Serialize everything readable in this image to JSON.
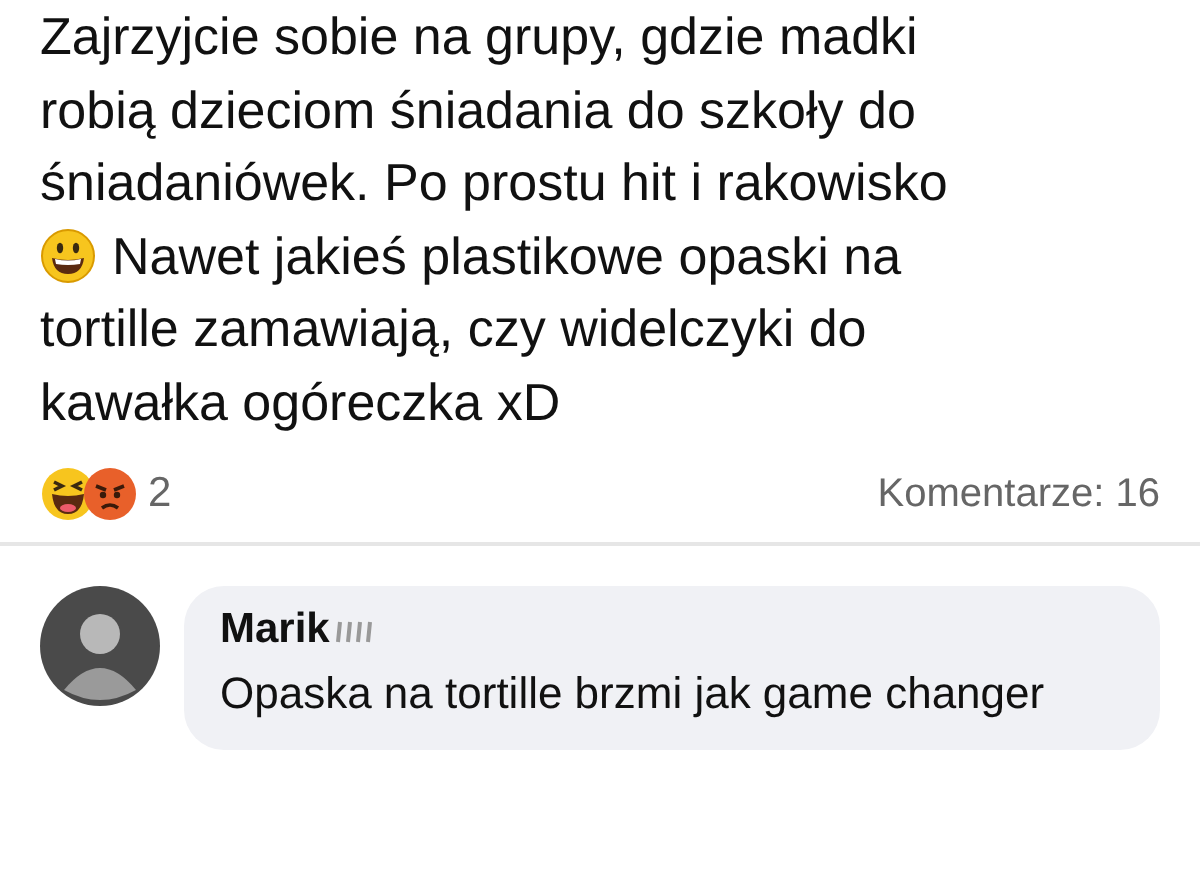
{
  "post": {
    "lines": [
      {
        "text": "Zajrzyjcie sobie na grupy, gdzie madki"
      },
      {
        "text": "robią dzieciom śniadania do szkoły do"
      },
      {
        "text": "śniadaniówek. Po prostu hit i rakowisko"
      },
      {
        "kind": "emoji",
        "text": "Nawet jakieś plastikowe opaski na"
      },
      {
        "text": "tortille zamawiają, czy widelczyki do"
      },
      {
        "text": "kawałka ogóreczka xD"
      }
    ]
  },
  "reactions": {
    "count": "2"
  },
  "comments_count": "Komentarze: 16",
  "comment": {
    "author": "Marik",
    "text": "Opaska na tortille brzmi jak game changer"
  }
}
